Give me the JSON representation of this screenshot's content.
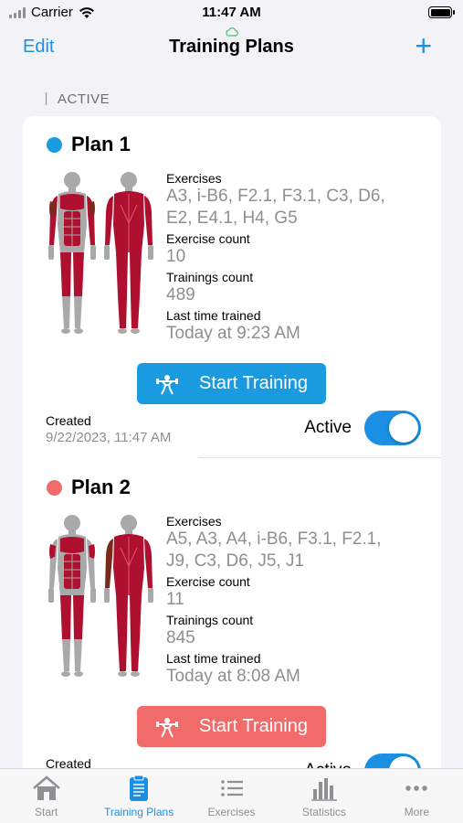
{
  "status_bar": {
    "carrier": "Carrier",
    "time": "11:47 AM"
  },
  "nav": {
    "edit_label": "Edit",
    "title": "Training Plans",
    "add_label": "+"
  },
  "section": {
    "header": "ACTIVE"
  },
  "plans": [
    {
      "name": "Plan 1",
      "dot_color": "#1a9be0",
      "exercises_label": "Exercises",
      "exercises_line1": "A3, i-B6, F2.1, F3.1, C3, D6,",
      "exercises_line2": "E2, E4.1, H4, G5",
      "exercise_count_label": "Exercise count",
      "exercise_count": "10",
      "trainings_count_label": "Trainings count",
      "trainings_count": "489",
      "last_trained_label": "Last time trained",
      "last_trained": "Today at 9:23 AM",
      "start_label": "Start Training",
      "button_color": "#1a9be0",
      "created_label": "Created",
      "created_date": "9/22/2023, 11:47 AM",
      "active_label": "Active"
    },
    {
      "name": "Plan 2",
      "dot_color": "#f26b6b",
      "exercises_label": "Exercises",
      "exercises_line1": "A5, A3, A4, i-B6, F3.1, F2.1,",
      "exercises_line2": "J9, C3, D6, J5, J1",
      "exercise_count_label": "Exercise count",
      "exercise_count": "11",
      "trainings_count_label": "Trainings count",
      "trainings_count": "845",
      "last_trained_label": "Last time trained",
      "last_trained": "Today at 8:08 AM",
      "start_label": "Start Training",
      "button_color": "#f26b6b",
      "created_label": "Created",
      "active_label": "Active"
    }
  ],
  "tabs": [
    {
      "label": "Start",
      "icon": "house-icon"
    },
    {
      "label": "Training Plans",
      "icon": "clipboard-icon",
      "active": true
    },
    {
      "label": "Exercises",
      "icon": "list-icon"
    },
    {
      "label": "Statistics",
      "icon": "bar-chart-icon"
    },
    {
      "label": "More",
      "icon": "ellipsis-icon"
    }
  ],
  "colors": {
    "accent": "#1a8fe3",
    "muscle": "#b0102f",
    "body": "#a9a9a9"
  }
}
